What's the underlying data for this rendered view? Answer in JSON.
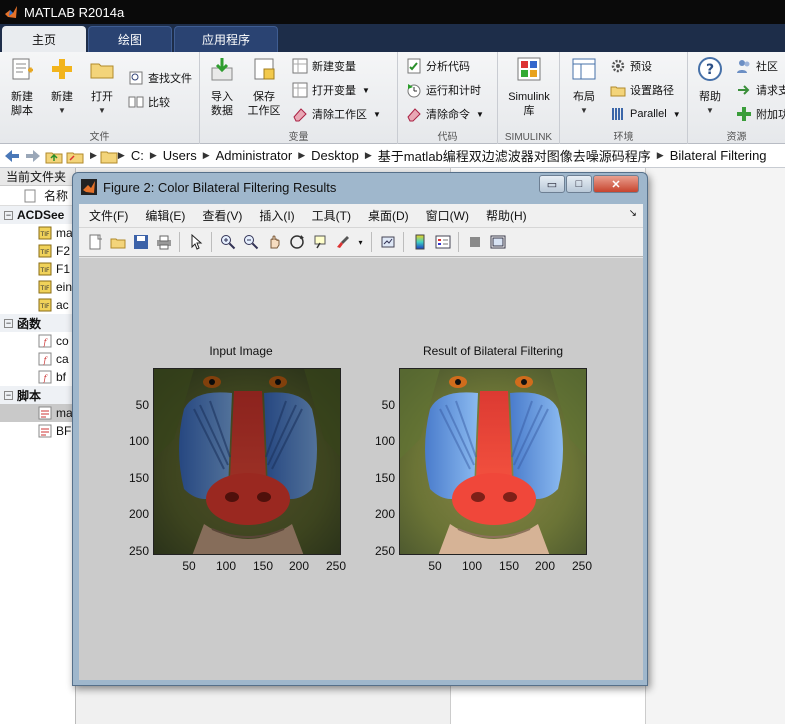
{
  "app": {
    "title": "MATLAB R2014a"
  },
  "tabs": [
    {
      "label": "主页",
      "active": true
    },
    {
      "label": "绘图",
      "active": false
    },
    {
      "label": "应用程序",
      "active": false
    }
  ],
  "ribbon": {
    "file": {
      "group_label": "文件",
      "new_script": "新建\n脚本",
      "new_script_a": "新建",
      "new_script_b": "脚本",
      "new": "新建",
      "open": "打开",
      "find_files": "查找文件",
      "compare": "比较"
    },
    "variable": {
      "group_label": "变量",
      "import_a": "导入",
      "import_b": "数据",
      "save_a": "保存",
      "save_b": "工作区",
      "new_var": "新建变量",
      "open_var": "打开变量",
      "clear_ws": "清除工作区"
    },
    "code": {
      "group_label": "代码",
      "analyze": "分析代码",
      "run_time": "运行和计时",
      "clear_cmd": "清除命令"
    },
    "simulink": {
      "group_label": "SIMULINK",
      "lib_a": "Simulink",
      "lib_b": "库"
    },
    "env": {
      "group_label": "环境",
      "layout": "布局",
      "prefs": "预设",
      "set_path": "设置路径",
      "parallel": "Parallel"
    },
    "resources": {
      "group_label": "资源",
      "help": "帮助",
      "community": "社区",
      "request": "请求支",
      "addons": "附加功"
    }
  },
  "address": {
    "crumbs": [
      "C:",
      "Users",
      "Administrator",
      "Desktop",
      "基于matlab编程双边滤波器对图像去噪源码程序",
      "Bilateral Filtering"
    ]
  },
  "left_panel": {
    "header": "当前文件夹",
    "col_name": "名称",
    "sections": [
      {
        "label": "ACDSee",
        "items": [
          "ma",
          "F2",
          "F1",
          "ein",
          "ac"
        ]
      },
      {
        "label": "函数",
        "items": [
          "co",
          "ca",
          "bf"
        ]
      },
      {
        "label": "脚本",
        "items": [
          "ma",
          "BF"
        ]
      }
    ]
  },
  "figure": {
    "title": "Figure 2: Color Bilateral Filtering Results",
    "window_controls": {
      "minimize": "▭",
      "maximize": "□",
      "close": "✕"
    },
    "menu": [
      "文件(F)",
      "编辑(E)",
      "查看(V)",
      "插入(I)",
      "工具(T)",
      "桌面(D)",
      "窗口(W)",
      "帮助(H)"
    ],
    "menu_arrow": "↘",
    "plots": [
      {
        "title": "Input Image",
        "yticks": [
          "50",
          "100",
          "150",
          "200",
          "250"
        ],
        "xticks": [
          "50",
          "100",
          "150",
          "200",
          "250"
        ]
      },
      {
        "title": "Result of Bilateral Filtering",
        "yticks": [
          "50",
          "100",
          "150",
          "200",
          "250"
        ],
        "xticks": [
          "50",
          "100",
          "150",
          "200",
          "250"
        ]
      }
    ]
  },
  "colors": {
    "tab_bar": "#1d2d49",
    "figure_bg": "#cbcbcb",
    "window_frame": "#9fb7cc"
  }
}
